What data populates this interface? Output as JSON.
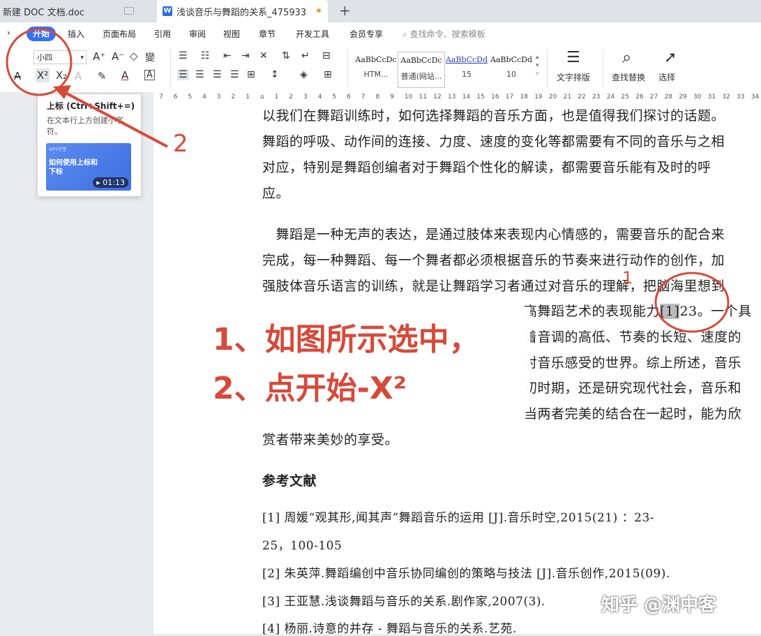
{
  "tabs": [
    {
      "label": "新建 DOC 文档.doc"
    },
    {
      "label": "浅谈音乐与舞蹈的关系_475933"
    }
  ],
  "menu": [
    "开始",
    "插入",
    "页面布局",
    "引用",
    "审阅",
    "视图",
    "章节",
    "开发工具",
    "会员专享"
  ],
  "search_placeholder": "查找命令、搜索模板",
  "toolbar": {
    "font_size": "小四",
    "superscript": "X²",
    "subscript": "X₂",
    "styles": [
      {
        "preview": "AaBbCcDc",
        "name": "HTM..."
      },
      {
        "preview": "AaBbCcDc",
        "name": "普通(网站..."
      },
      {
        "preview": "AaBbCcDd",
        "name": "15"
      },
      {
        "preview": "AaBbCcDd",
        "name": "10"
      }
    ],
    "text_layout": "文字排版",
    "find_replace": "查找替换",
    "select": "选择"
  },
  "ruler": [
    "7",
    "6",
    "5",
    "4",
    "3",
    "2",
    "1",
    "",
    "1",
    "2",
    "3",
    "4",
    "5",
    "6",
    "7",
    "8",
    "9",
    "10",
    "11",
    "12",
    "13",
    "14",
    "15",
    "16",
    "17",
    "18",
    "19",
    "20",
    "21",
    "22",
    "23",
    "24",
    "25",
    "26",
    "27",
    "28",
    "29",
    "30",
    "31",
    "32",
    "33",
    "34"
  ],
  "tooltip": {
    "title": "上标 (Ctrl+Shift+=)",
    "desc": "在文本行上方创建小字符。",
    "video_brand": "WPS学堂",
    "video_title": "如何使用上标和下标",
    "video_time": "01:13"
  },
  "doc": {
    "lines": [
      "以我们在舞蹈训练时，如何选择舞蹈的音乐方面，也是值得我们探讨的话题。",
      "舞蹈的呼吸、动作间的连接、力度、速度的变化等都需要有不同的音乐与之相",
      "对应，特别是舞蹈创编者对于舞蹈个性化的解读，都需要音乐能有及时的呼",
      "应。",
      "　舞蹈是一种无声的表达，是通过肢体来表现内心情感的，需要音乐的配合来",
      "完成，每一种舞蹈、每一个舞者都必须根据音乐的节奏来进行动作的创作，加",
      "强肢体音乐语言的训练，就是让舞蹈学习者通过对音乐的理解，把脑海里想到"
    ],
    "line8_pre": "高舞蹈艺术的表现能力",
    "line8_sel": "[1]",
    "line8_post": "23。一个具",
    "line9": "着音调的高低、节奏的长短、速度的",
    "line10": "对音乐感受的世界。综上所述，音乐",
    "line11": "初时期，还是研究现代社会，音乐和",
    "line12": "当两者完美的结合在一起时，能为欣",
    "line13": "赏者带来美妙的享受。",
    "heading": "参考文献",
    "refs": [
      "[1] 周媛“观其形,闻其声”舞蹈音乐的运用 [J].音乐时空,2015(21) ：23-",
      "25，100-105",
      "[2] 朱英萍.舞蹈编创中音乐协同编创的策略与技法 [J].音乐创作,2015(09).",
      "[3] 王亚慧.浅谈舞蹈与音乐的关系.剧作家,2007(3).",
      "[4] 杨丽.诗意的并存 - 舞蹈与音乐的关系.艺苑."
    ]
  },
  "annotations": {
    "line1": "1、如图所示选中，",
    "line2": "2、点开始-X²",
    "num2": "2",
    "num1": "1"
  },
  "watermark": "知乎 @渊中客",
  "colors": {
    "accent": "#3370ff",
    "annotation": "#d64a3a"
  }
}
